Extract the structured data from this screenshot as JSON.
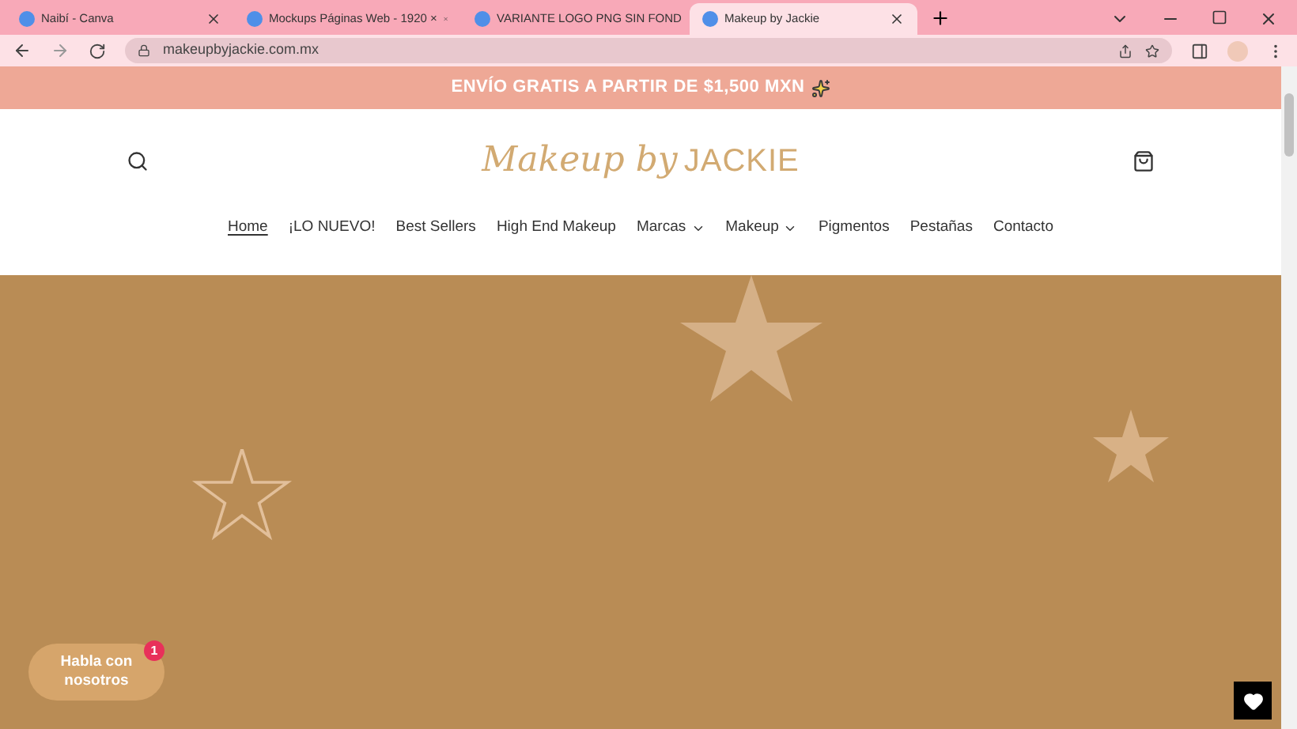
{
  "browser": {
    "tabs": [
      {
        "title": "Naibí - Canva",
        "selected": false
      },
      {
        "title": "Mockups Páginas Web - 1920 ×",
        "selected": false
      },
      {
        "title": "VARIANTE LOGO PNG SIN FOND",
        "selected": false
      },
      {
        "title": "Makeup by Jackie",
        "selected": true
      }
    ],
    "url": "makeupbyjackie.com.mx"
  },
  "announcement": "ENVÍO GRATIS A PARTIR DE $1,500 MXN",
  "logo": {
    "script": "Makeup by",
    "name": "JACKIE"
  },
  "nav": [
    {
      "label": "Home",
      "selected": true,
      "dropdown": false
    },
    {
      "label": "¡LO NUEVO!",
      "selected": false,
      "dropdown": false
    },
    {
      "label": "Best Sellers",
      "selected": false,
      "dropdown": false
    },
    {
      "label": "High End Makeup",
      "selected": false,
      "dropdown": false
    },
    {
      "label": "Marcas",
      "selected": false,
      "dropdown": true
    },
    {
      "label": "Makeup",
      "selected": false,
      "dropdown": true
    },
    {
      "label": "Pigmentos",
      "selected": false,
      "dropdown": false
    },
    {
      "label": "Pestañas",
      "selected": false,
      "dropdown": false
    },
    {
      "label": "Contacto",
      "selected": false,
      "dropdown": false
    }
  ],
  "chat": {
    "label": "Habla con nosotros",
    "badge": "1"
  }
}
